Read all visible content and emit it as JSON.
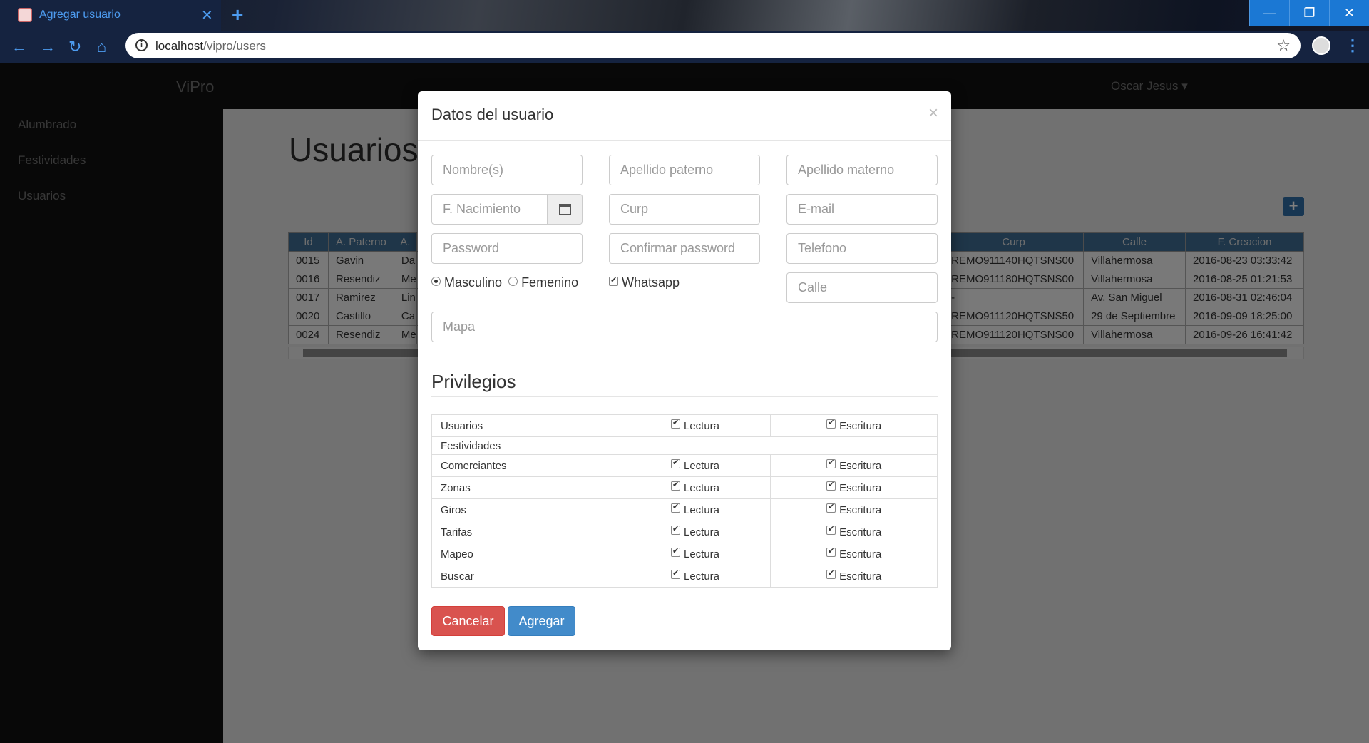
{
  "browser": {
    "tab_title": "Agregar usuario",
    "url_host": "localhost",
    "url_path": "/vipro/users"
  },
  "app": {
    "brand": "ViPro",
    "user": "Oscar Jesus",
    "sidebar": [
      "Alumbrado",
      "Festividades",
      "Usuarios"
    ],
    "page_title": "Usuarios"
  },
  "table": {
    "left_headers": [
      "Id",
      "A. Paterno",
      "A."
    ],
    "right_headers": [
      "Curp",
      "Calle",
      "F. Creacion"
    ],
    "rows": [
      {
        "id": "0015",
        "paterno": "Gavin",
        "materno": "Da",
        "curp": "REMO911140HQTSNS00",
        "calle": "Villahermosa",
        "fecha": "2016-08-23 03:33:42"
      },
      {
        "id": "0016",
        "paterno": "Resendiz",
        "materno": "Me",
        "curp": "REMO911180HQTSNS00",
        "calle": "Villahermosa",
        "fecha": "2016-08-25 01:21:53"
      },
      {
        "id": "0017",
        "paterno": "Ramirez",
        "materno": "Lin",
        "curp": "-",
        "calle": "Av. San Miguel",
        "fecha": "2016-08-31 02:46:04"
      },
      {
        "id": "0020",
        "paterno": "Castillo",
        "materno": "Ca",
        "curp": "REMO911120HQTSNS50",
        "calle": "29 de Septiembre",
        "fecha": "2016-09-09 18:25:00"
      },
      {
        "id": "0024",
        "paterno": "Resendiz",
        "materno": "Me",
        "curp": "REMO911120HQTSNS00",
        "calle": "Villahermosa",
        "fecha": "2016-09-26 16:41:42"
      }
    ]
  },
  "modal": {
    "title": "Datos del usuario",
    "fields": {
      "nombre": "Nombre(s)",
      "apellido_paterno": "Apellido paterno",
      "apellido_materno": "Apellido materno",
      "nacimiento": "F. Nacimiento",
      "curp": "Curp",
      "email": "E-mail",
      "password": "Password",
      "confirmar": "Confirmar password",
      "telefono": "Telefono",
      "calle": "Calle",
      "mapa": "Mapa"
    },
    "gender": {
      "masculino": "Masculino",
      "femenino": "Femenino",
      "selected": "Masculino"
    },
    "whatsapp": {
      "label": "Whatsapp",
      "checked": true
    },
    "privileges_title": "Privilegios",
    "read_label": "Lectura",
    "write_label": "Escritura",
    "privileges": [
      {
        "name": "Usuarios",
        "group": false
      },
      {
        "name": "Festividades",
        "group": true
      },
      {
        "name": "Comerciantes",
        "group": false
      },
      {
        "name": "Zonas",
        "group": false
      },
      {
        "name": "Giros",
        "group": false
      },
      {
        "name": "Tarifas",
        "group": false
      },
      {
        "name": "Mapeo",
        "group": false
      },
      {
        "name": "Buscar",
        "group": false
      }
    ],
    "cancel": "Cancelar",
    "add": "Agregar"
  }
}
